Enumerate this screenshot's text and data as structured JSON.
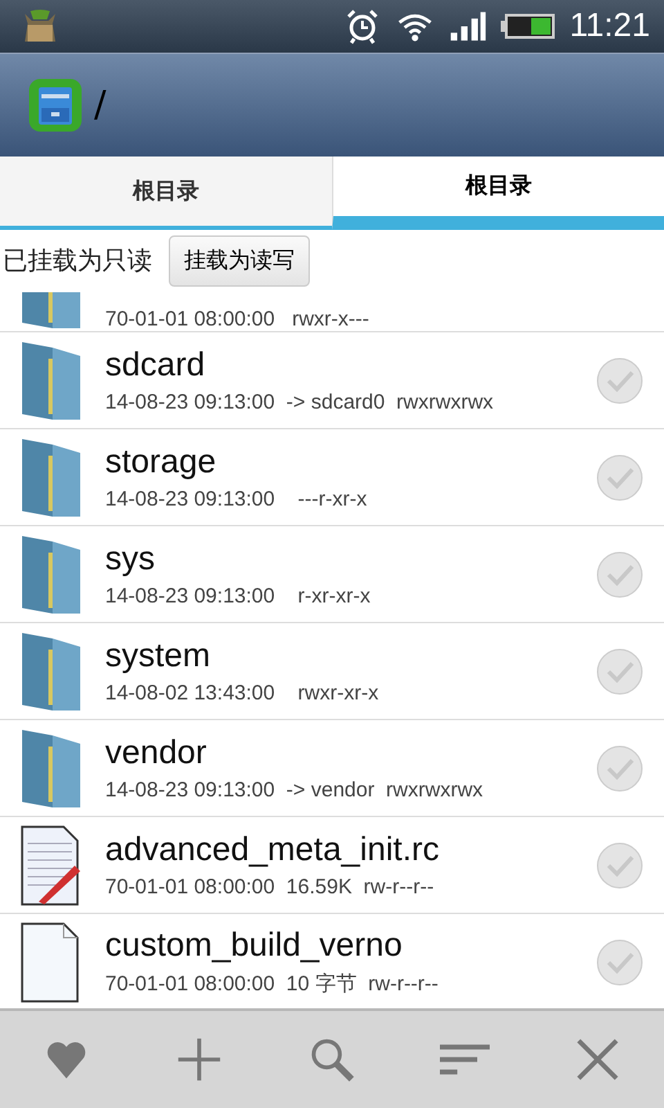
{
  "status_bar": {
    "time": "11:21"
  },
  "title_bar": {
    "path": "/"
  },
  "tabs": [
    {
      "label": "根目录",
      "selected": false
    },
    {
      "label": "根目录",
      "selected": true
    }
  ],
  "mount_bar": {
    "status": "已挂载为只读",
    "button": "挂载为读写"
  },
  "files": [
    {
      "kind": "folder",
      "details": "70-01-01 08:00:00   rwxr-x---"
    },
    {
      "kind": "folder",
      "name": "sdcard",
      "details": "14-08-23 09:13:00  -> sdcard0  rwxrwxrwx",
      "checked": false
    },
    {
      "kind": "folder",
      "name": "storage",
      "details": "14-08-23 09:13:00    ---r-xr-x",
      "checked": false
    },
    {
      "kind": "folder",
      "name": "sys",
      "details": "14-08-23 09:13:00    r-xr-xr-x",
      "checked": false
    },
    {
      "kind": "folder",
      "name": "system",
      "details": "14-08-02 13:43:00    rwxr-xr-x",
      "checked": false
    },
    {
      "kind": "folder",
      "name": "vendor",
      "details": "14-08-23 09:13:00  -> vendor  rwxrwxrwx",
      "checked": false
    },
    {
      "kind": "text",
      "name": "advanced_meta_init.rc",
      "details": "70-01-01 08:00:00  16.59K  rw-r--r--",
      "checked": false
    },
    {
      "kind": "file",
      "name": "custom_build_verno",
      "details": "70-01-01 08:00:00  10 字节  rw-r--r--",
      "checked": false
    }
  ]
}
